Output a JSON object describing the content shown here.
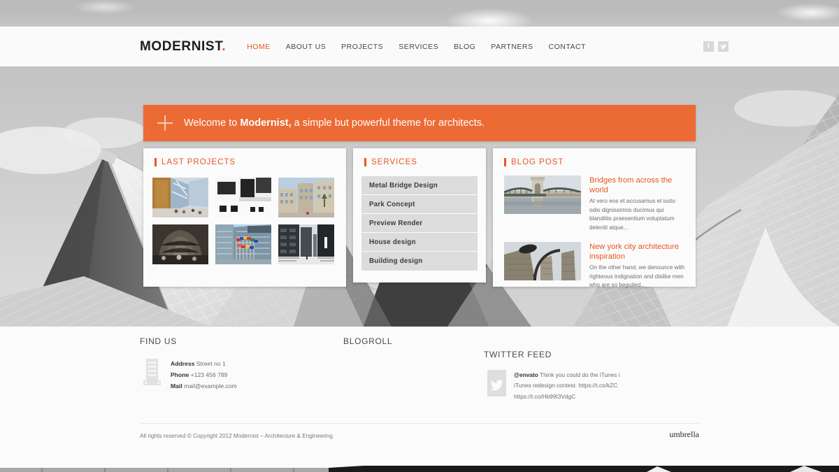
{
  "header": {
    "logo_text": "MODERNIST",
    "logo_dot": ".",
    "nav": [
      {
        "label": "HOME",
        "active": true
      },
      {
        "label": "ABOUT US",
        "active": false
      },
      {
        "label": "PROJECTS",
        "active": false
      },
      {
        "label": "SERVICES",
        "active": false
      },
      {
        "label": "BLOG",
        "active": false
      },
      {
        "label": "PARTNERS",
        "active": false
      },
      {
        "label": "CONTACT",
        "active": false
      }
    ],
    "social": [
      {
        "name": "facebook-icon",
        "glyph": "f"
      },
      {
        "name": "twitter-icon",
        "glyph": "ᴠ"
      }
    ]
  },
  "banner": {
    "icon": "plus-icon",
    "text_before": "Welcome to ",
    "text_bold": "Modernist,",
    "text_after": " a simple but powerful theme for architects.",
    "bg_color": "#ec6a34"
  },
  "panels": {
    "projects": {
      "title": "LAST PROJECTS",
      "thumbs": [
        {
          "name": "project-thumb-atrium",
          "alt": "glass atrium interior"
        },
        {
          "name": "project-thumb-white-building",
          "alt": "white and black facade"
        },
        {
          "name": "project-thumb-plaza",
          "alt": "tan buildings plaza"
        },
        {
          "name": "project-thumb-vault",
          "alt": "vaulted hall interior"
        },
        {
          "name": "project-thumb-flags",
          "alt": "glass building with flags"
        },
        {
          "name": "project-thumb-towers",
          "alt": "dark office towers walkway"
        }
      ]
    },
    "services": {
      "title": "SERVICES",
      "items": [
        "Metal Bridge Design",
        "Park Concept",
        "Preview Render",
        "House design",
        "Building design"
      ]
    },
    "blog": {
      "title": "BLOG POST",
      "posts": [
        {
          "thumb": "blog-thumb-bridge",
          "title": "Bridges from across the world",
          "excerpt": "At vero eos et accusamus et iusto odio dignissimos ducimus qui blanditiis praesentium voluptatum deleniti atque..."
        },
        {
          "thumb": "blog-thumb-nyc",
          "title": "New york city architecture inspiration",
          "excerpt": "On the other hand, we denounce with righteous indignation and dislike men who are so beguiled..."
        }
      ]
    }
  },
  "footer": {
    "find_us": {
      "heading": "FIND US",
      "icon": "building-icon",
      "rows": [
        {
          "label": "Address",
          "value": " Street no 1"
        },
        {
          "label": "Phone",
          "value": " +123 456 789"
        },
        {
          "label": "Mail",
          "value": " mail@example.com"
        }
      ]
    },
    "blogroll": {
      "heading": "BLOGROLL"
    },
    "twitter": {
      "heading": "TWITTER FEED",
      "icon": "twitter-bird-icon",
      "handle": "@envato",
      "line1": " Think you could do the iTunes i",
      "line2": "iTunes redesign contest. https://t.co/kZC",
      "line3": "https://t.co/Hb99I3VdgC"
    },
    "copyright": "All rights reserved © Copyright 2012 Modernist – Architecture & Engineering",
    "brand": "umbrella"
  },
  "colors": {
    "accent": "#e8561f",
    "banner": "#ec6a34",
    "page_bg": "#fbfbfb",
    "service_row": "#dcdcdc"
  }
}
